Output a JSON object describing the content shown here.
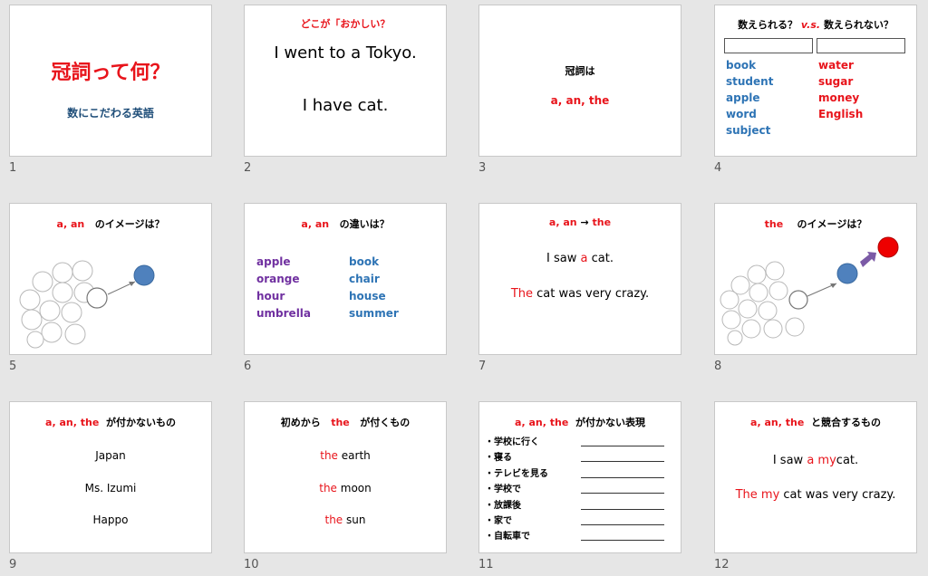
{
  "slides": [
    {
      "num": "1",
      "title": "冠詞って何？",
      "subtitle": "数にこだわる英語"
    },
    {
      "num": "2",
      "title_a": "どこが",
      "title_b": "「おかしい？",
      "line1": "I went to a Tokyo.",
      "line2": "I have cat."
    },
    {
      "num": "3",
      "title": "冠詞は",
      "body": "a, an, the"
    },
    {
      "num": "4",
      "title_a": "数えられる？",
      "title_vs": "v.s.",
      "title_b": "数えられない？",
      "countable": [
        "book",
        "student",
        "apple",
        "word",
        "subject"
      ],
      "uncountable": [
        "water",
        "sugar",
        "money",
        "English"
      ]
    },
    {
      "num": "5",
      "title_red": "a, an",
      "title_black": "のイメージは？"
    },
    {
      "num": "6",
      "title_red": "a, an",
      "title_black": "の違いは？",
      "vowel_words": [
        "apple",
        "orange",
        "hour",
        "umbrella"
      ],
      "consonant_words": [
        "book",
        "chair",
        "house",
        "summer"
      ]
    },
    {
      "num": "7",
      "title_a": "a, an",
      "title_arrow": "→",
      "title_b": "the",
      "s1_a": "I saw ",
      "s1_b": "a",
      "s1_c": " cat.",
      "s2_a": "The",
      "s2_b": " cat was very crazy."
    },
    {
      "num": "8",
      "title_red": "the",
      "title_black": "のイメージは？"
    },
    {
      "num": "9",
      "title_red": "a, an, the",
      "title_black": "が付かないもの",
      "items": [
        "Japan",
        "Ms. Izumi",
        "Happo"
      ]
    },
    {
      "num": "10",
      "title_a": "初めから",
      "title_red": "the",
      "title_b": "が付くもの",
      "items": [
        {
          "art": "the",
          "word": " earth"
        },
        {
          "art": "the",
          "word": " moon"
        },
        {
          "art": "the",
          "word": " sun"
        }
      ]
    },
    {
      "num": "11",
      "title_red": "a, an, the",
      "title_black": "が付かない表現",
      "items": [
        "・学校に行く",
        "・寝る",
        "・テレビを見る",
        "・学校で",
        "・放課後",
        "・家で",
        "・自転車で"
      ]
    },
    {
      "num": "12",
      "title_red": "a, an, the",
      "title_black": "と競合するもの",
      "s1_a": "I saw ",
      "s1_b": "a my",
      "s1_c": "cat.",
      "s2_a": "The my",
      "s2_b": " cat was very crazy."
    }
  ]
}
